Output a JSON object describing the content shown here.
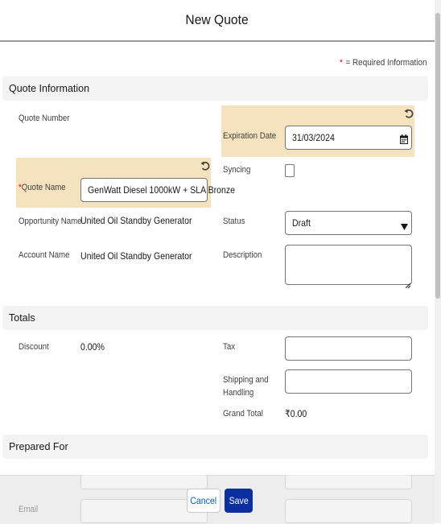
{
  "modal": {
    "title": "New Quote"
  },
  "required_legend": {
    "star": "*",
    "text": "= Required Information"
  },
  "sections": {
    "quote_info": "Quote Information",
    "totals": "Totals",
    "prepared_for": "Prepared For"
  },
  "quote_info": {
    "quote_number_label": "Quote Number",
    "expiration_date_label": "Expiration Date",
    "expiration_date_value": "31/03/2024",
    "quote_name_required": "*",
    "quote_name_label": "Quote Name",
    "quote_name_value": "GenWatt Diesel 1000kW + SLA Bronze",
    "syncing_label": "Syncing",
    "opportunity_name_label": "Opportunity Name",
    "opportunity_name_value": "United Oil Standby Generator",
    "status_label": "Status",
    "status_value": "Draft",
    "account_name_label": "Account Name",
    "account_name_value": "United Oil Standby Generator",
    "description_label": "Description"
  },
  "totals": {
    "discount_label": "Discount",
    "discount_value": "0.00%",
    "tax_label": "Tax",
    "shipping_label_line1": "Shipping and",
    "shipping_label_line2": "Handling",
    "grand_total_label": "Grand Total",
    "grand_total_value": "₹0.00"
  },
  "prepared_for": {
    "email_label": "Email"
  },
  "footer": {
    "cancel_label": "Cancel",
    "save_label": "Save"
  },
  "icons": {
    "undo": "undo-icon",
    "calendar": "calendar-icon",
    "dropdown": "chevron-down-icon"
  },
  "colors": {
    "highlight": "#f5e3bf",
    "section_bg": "#f3f3f3",
    "required": "#ba0517",
    "brand": "#0b2f9e",
    "link": "#0b5cab"
  }
}
